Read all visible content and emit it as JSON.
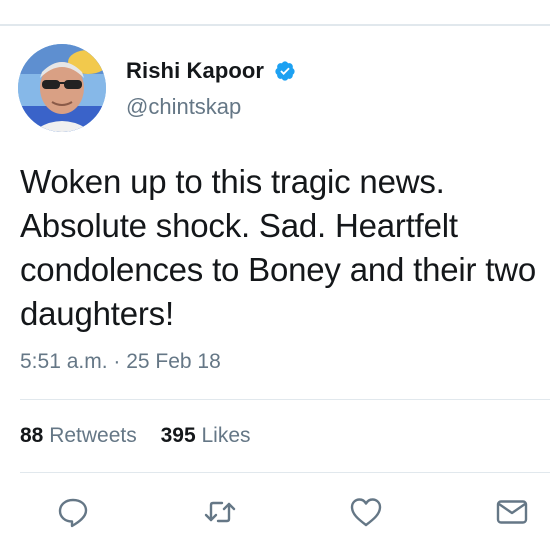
{
  "tweet": {
    "display_name": "Rishi Kapoor",
    "handle": "@chintskap",
    "text": "Woken up to this tragic news. Absolute shock. Sad. Heartfelt condolences to Boney and their two daughters!",
    "timestamp": "5:51 a.m. · 25 Feb 18",
    "retweets_count": "88",
    "retweets_label": "Retweets",
    "likes_count": "395",
    "likes_label": "Likes"
  },
  "icons": {
    "verified": "verified-badge-icon",
    "reply": "reply-icon",
    "retweet": "retweet-icon",
    "like": "heart-icon",
    "share": "mail-icon"
  },
  "colors": {
    "verified_blue": "#1da1f2",
    "icon_gray": "#657786",
    "text": "#14171a",
    "divider": "#e1e8ed"
  }
}
